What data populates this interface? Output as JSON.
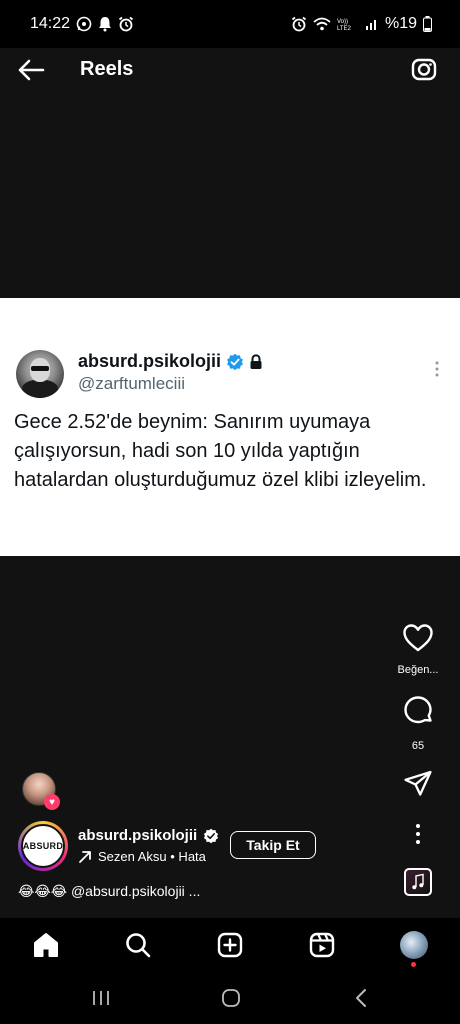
{
  "status_bar": {
    "time": "14:22",
    "battery": "%19",
    "left_icons": [
      "whatsapp-icon",
      "bell-icon",
      "alarm-icon"
    ],
    "right_icons": [
      "alarm-icon",
      "wifi-icon",
      "volte-icon",
      "signal-icon",
      "battery-icon"
    ]
  },
  "header": {
    "title": "Reels"
  },
  "tweet": {
    "name": "absurd.psikolojii",
    "handle": "@zarftumleciii",
    "text": "Gece 2.52'de beynim: Sanırım uyumaya çalışıyorsun, hadi son 10 yılda yaptığın hatalardan oluşturduğumuz özel klibi izleyelim."
  },
  "actions": {
    "like_label": "Beğen...",
    "comment_count": "65"
  },
  "author": {
    "logo_text": "ABSURD",
    "name": "absurd.psikolojii",
    "audio": "Sezen Aksu • Hata",
    "follow_label": "Takip Et"
  },
  "caption": "😂😂😂 @absurd.psikolojii ...",
  "colors": {
    "background": "#121212",
    "verified_blue": "#1d9bf0",
    "like_heart": "#ff3b6b"
  }
}
